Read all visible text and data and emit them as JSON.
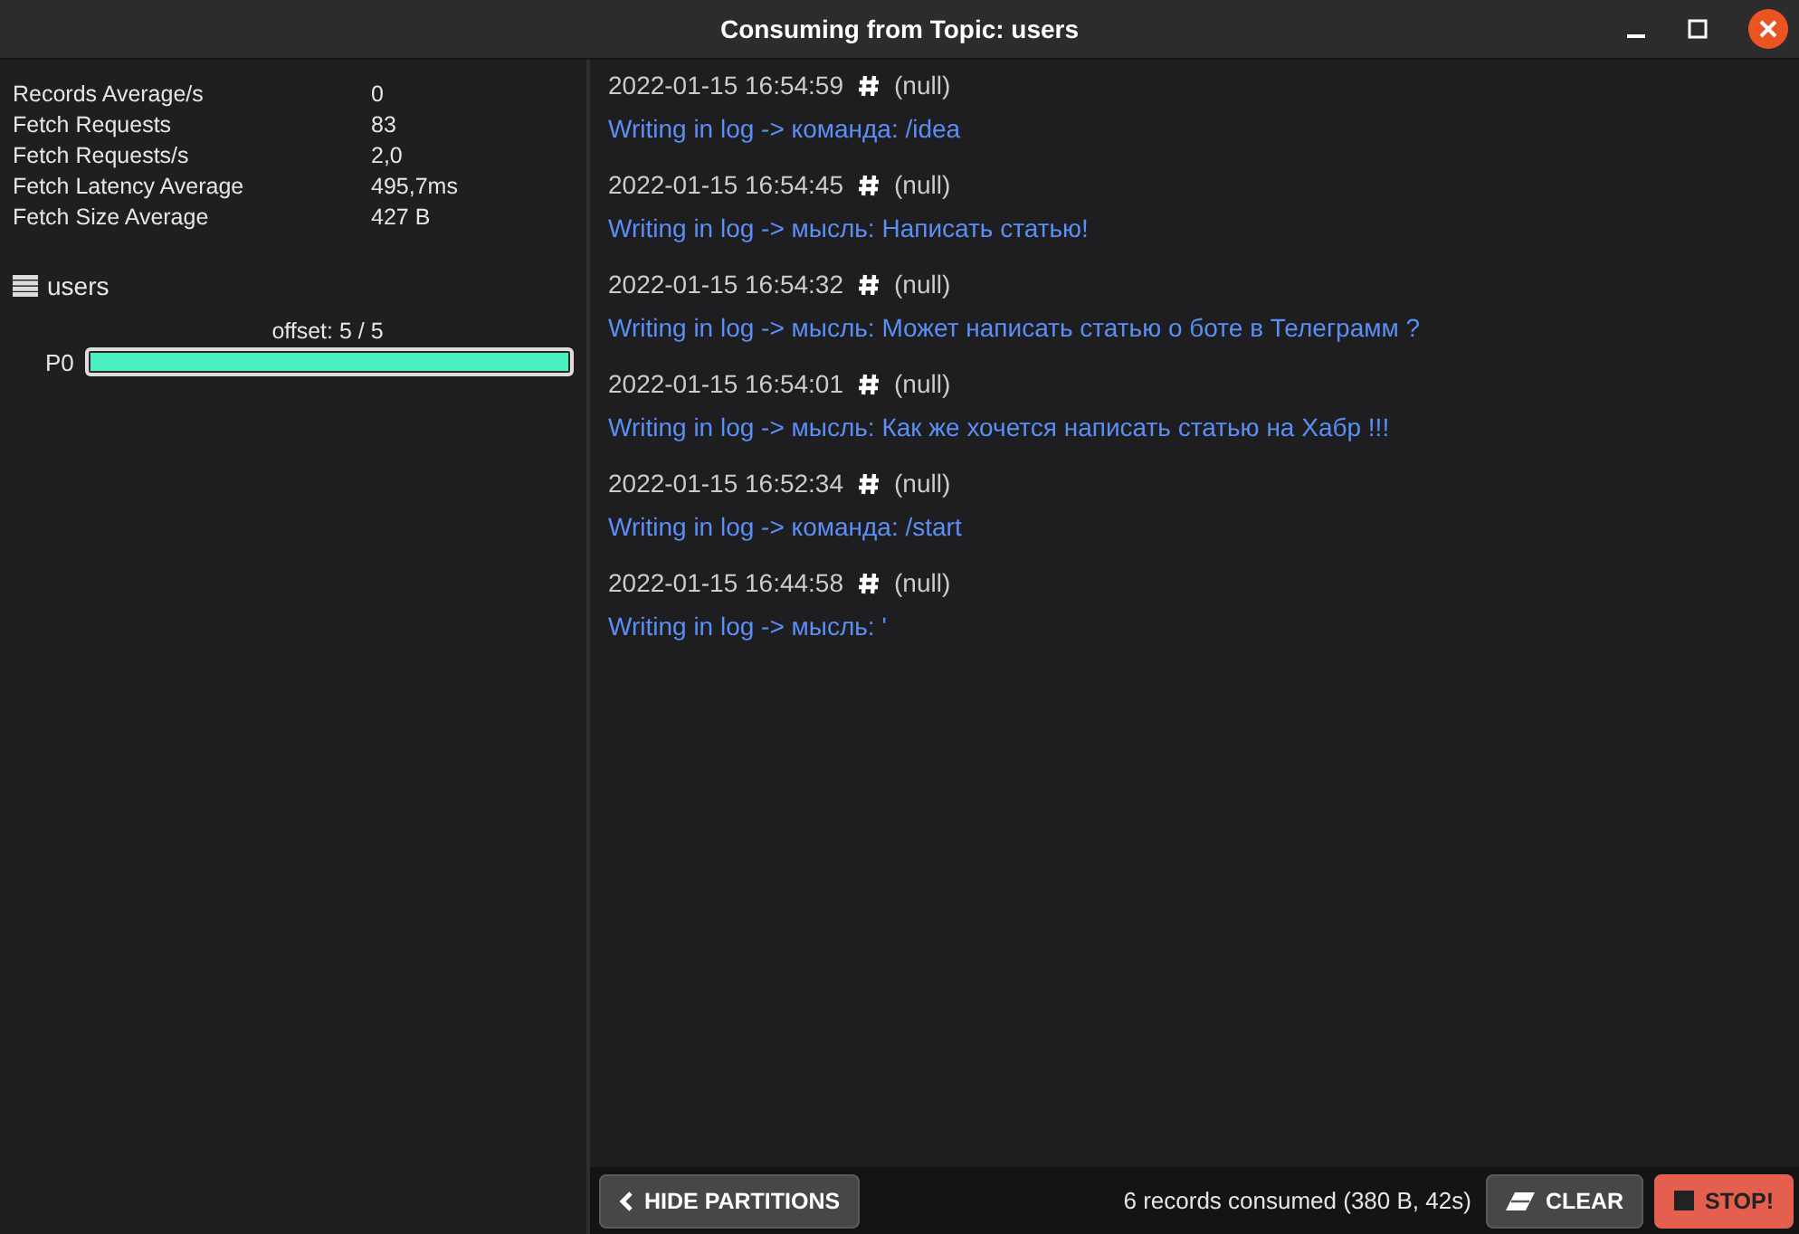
{
  "window": {
    "title": "Consuming from Topic: users"
  },
  "stats": [
    {
      "label": "Records Average/s",
      "value": "0"
    },
    {
      "label": "Fetch Requests",
      "value": "83"
    },
    {
      "label": "Fetch Requests/s",
      "value": "2,0"
    },
    {
      "label": "Fetch Latency Average",
      "value": "495,7ms"
    },
    {
      "label": "Fetch Size Average",
      "value": "427 B"
    }
  ],
  "topic": {
    "name": "users",
    "partitions": [
      {
        "name": "P0",
        "offset": "offset: 5 / 5",
        "level": 1
      }
    ]
  },
  "records": [
    {
      "time": "2022-01-15 16:54:59",
      "key": "(null)",
      "value": "Writing in log -> команда: /idea"
    },
    {
      "time": "2022-01-15 16:54:45",
      "key": "(null)",
      "value": "Writing in log -> мысль: Написать статью!"
    },
    {
      "time": "2022-01-15 16:54:32",
      "key": "(null)",
      "value": "Writing in log -> мысль: Может написать статью о боте в Телеграмм ?"
    },
    {
      "time": "2022-01-15 16:54:01",
      "key": "(null)",
      "value": "Writing in log -> мысль: Как же хочется написать статью на Хабр !!!"
    },
    {
      "time": "2022-01-15 16:52:34",
      "key": "(null)",
      "value": "Writing in log -> команда: /start"
    },
    {
      "time": "2022-01-15 16:44:58",
      "key": "(null)",
      "value": "Writing in log -> мысль: '"
    }
  ],
  "footer": {
    "hide_button": "HIDE PARTITIONS",
    "status": "6 records consumed (380 B, 42s)",
    "clear_button": "CLEAR",
    "stop_button": "STOP!"
  }
}
